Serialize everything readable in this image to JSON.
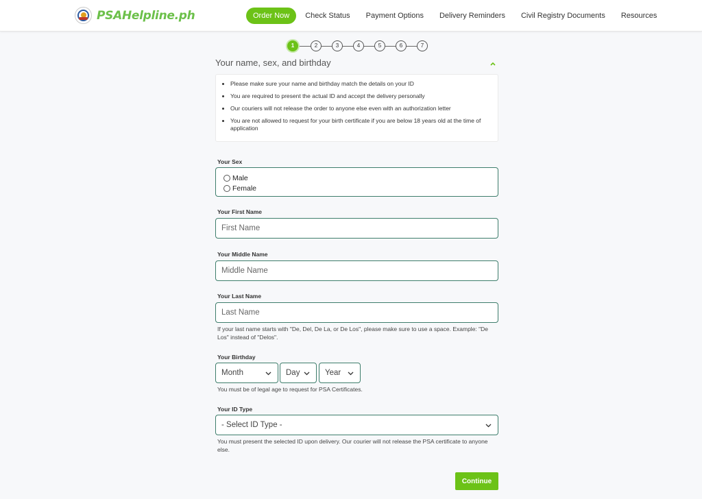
{
  "brand": {
    "name": "PSAHelpline.ph",
    "accent_color": "#6cc217",
    "logo_icon": "psa-seal-icon"
  },
  "nav": {
    "items": [
      {
        "label": "Order Now",
        "active": true
      },
      {
        "label": "Check Status"
      },
      {
        "label": "Payment Options"
      },
      {
        "label": "Delivery Reminders"
      },
      {
        "label": "Civil Registry Documents"
      },
      {
        "label": "Resources"
      }
    ]
  },
  "stepper": {
    "steps": [
      "1",
      "2",
      "3",
      "4",
      "5",
      "6",
      "7"
    ],
    "current": 1
  },
  "section": {
    "title": "Your name, sex, and birthday",
    "notes": [
      "Please make sure your name and birthday match the details on your ID",
      "You are required to present the actual ID and accept the delivery personally",
      "Our couriers will not release the order to anyone else even with an authorization letter",
      "You are not allowed to request for your birth certificate if you are below 18 years old at the time of application"
    ]
  },
  "form": {
    "sex": {
      "label": "Your Sex",
      "options": [
        "Male",
        "Female"
      ]
    },
    "first_name": {
      "label": "Your First Name",
      "placeholder": "First Name"
    },
    "middle_name": {
      "label": "Your Middle Name",
      "placeholder": "Middle Name"
    },
    "last_name": {
      "label": "Your Last Name",
      "placeholder": "Last Name",
      "hint": "If your last name starts with \"De, Del, De La, or De Los\", please make sure to use a space. Example: \"De Los\" instead of \"Delos\"."
    },
    "birthday": {
      "label": "Your Birthday",
      "month": "Month",
      "day": "Day",
      "year": "Year",
      "hint": "You must be of legal age to request for PSA Certificates."
    },
    "id_type": {
      "label": "Your ID Type",
      "selected": "- Select ID Type -",
      "hint": "You must present the selected ID upon delivery. Our courier will not release the PSA certificate to anyone else."
    },
    "continue_label": "Continue"
  }
}
